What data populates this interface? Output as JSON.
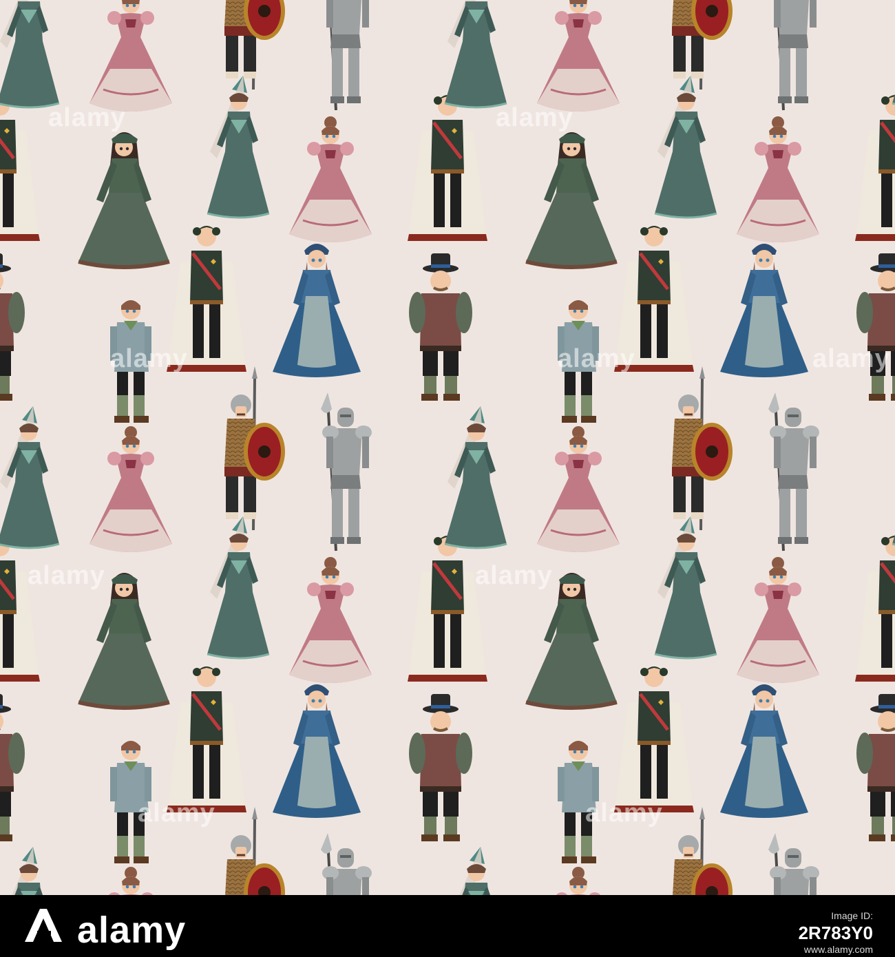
{
  "colors": {
    "background": "#efe5e0",
    "footer": "#000000",
    "teal_gown": "#4f6e68",
    "rose_gown": "#c07a86",
    "skirt_light": "#e4d0cb",
    "dark_green": "#2f3d33",
    "olive": "#5d6a57",
    "blue_gown": "#2f5f88",
    "brown_vest": "#7a4c45",
    "steel": "#9ea1a2",
    "shield_red": "#9a1f22",
    "shield_gold": "#b8842a",
    "skin": "#f1c7a6"
  },
  "pattern": {
    "watermark_text": "alamy",
    "figures": [
      {
        "kind": "lady-hennin",
        "label": "Lady with pointed hennin hat",
        "icon": "lady-hennin-icon"
      },
      {
        "kind": "princess-pink",
        "label": "Princess in pink gown",
        "icon": "princess-pink-icon"
      },
      {
        "kind": "shield-guard",
        "label": "Guard with round shield and spear",
        "icon": "shield-guard-icon"
      },
      {
        "kind": "armored-knight",
        "label": "Knight in plate armor with halberd",
        "icon": "armored-knight-icon"
      },
      {
        "kind": "lady-green",
        "label": "Lady in green dress",
        "icon": "lady-green-icon"
      },
      {
        "kind": "prince",
        "label": "Prince with ermine cape",
        "icon": "prince-icon"
      },
      {
        "kind": "boy",
        "label": "Boy in tunic",
        "icon": "boy-icon"
      },
      {
        "kind": "maid-blue",
        "label": "Maid in blue dress",
        "icon": "maid-blue-icon"
      },
      {
        "kind": "nobleman",
        "label": "Nobleman with hat",
        "icon": "nobleman-icon"
      }
    ]
  },
  "footer": {
    "brand": "alamy",
    "meta_label": "Image ID:",
    "image_id": "2R783Y0",
    "url": "www.alamy.com"
  }
}
